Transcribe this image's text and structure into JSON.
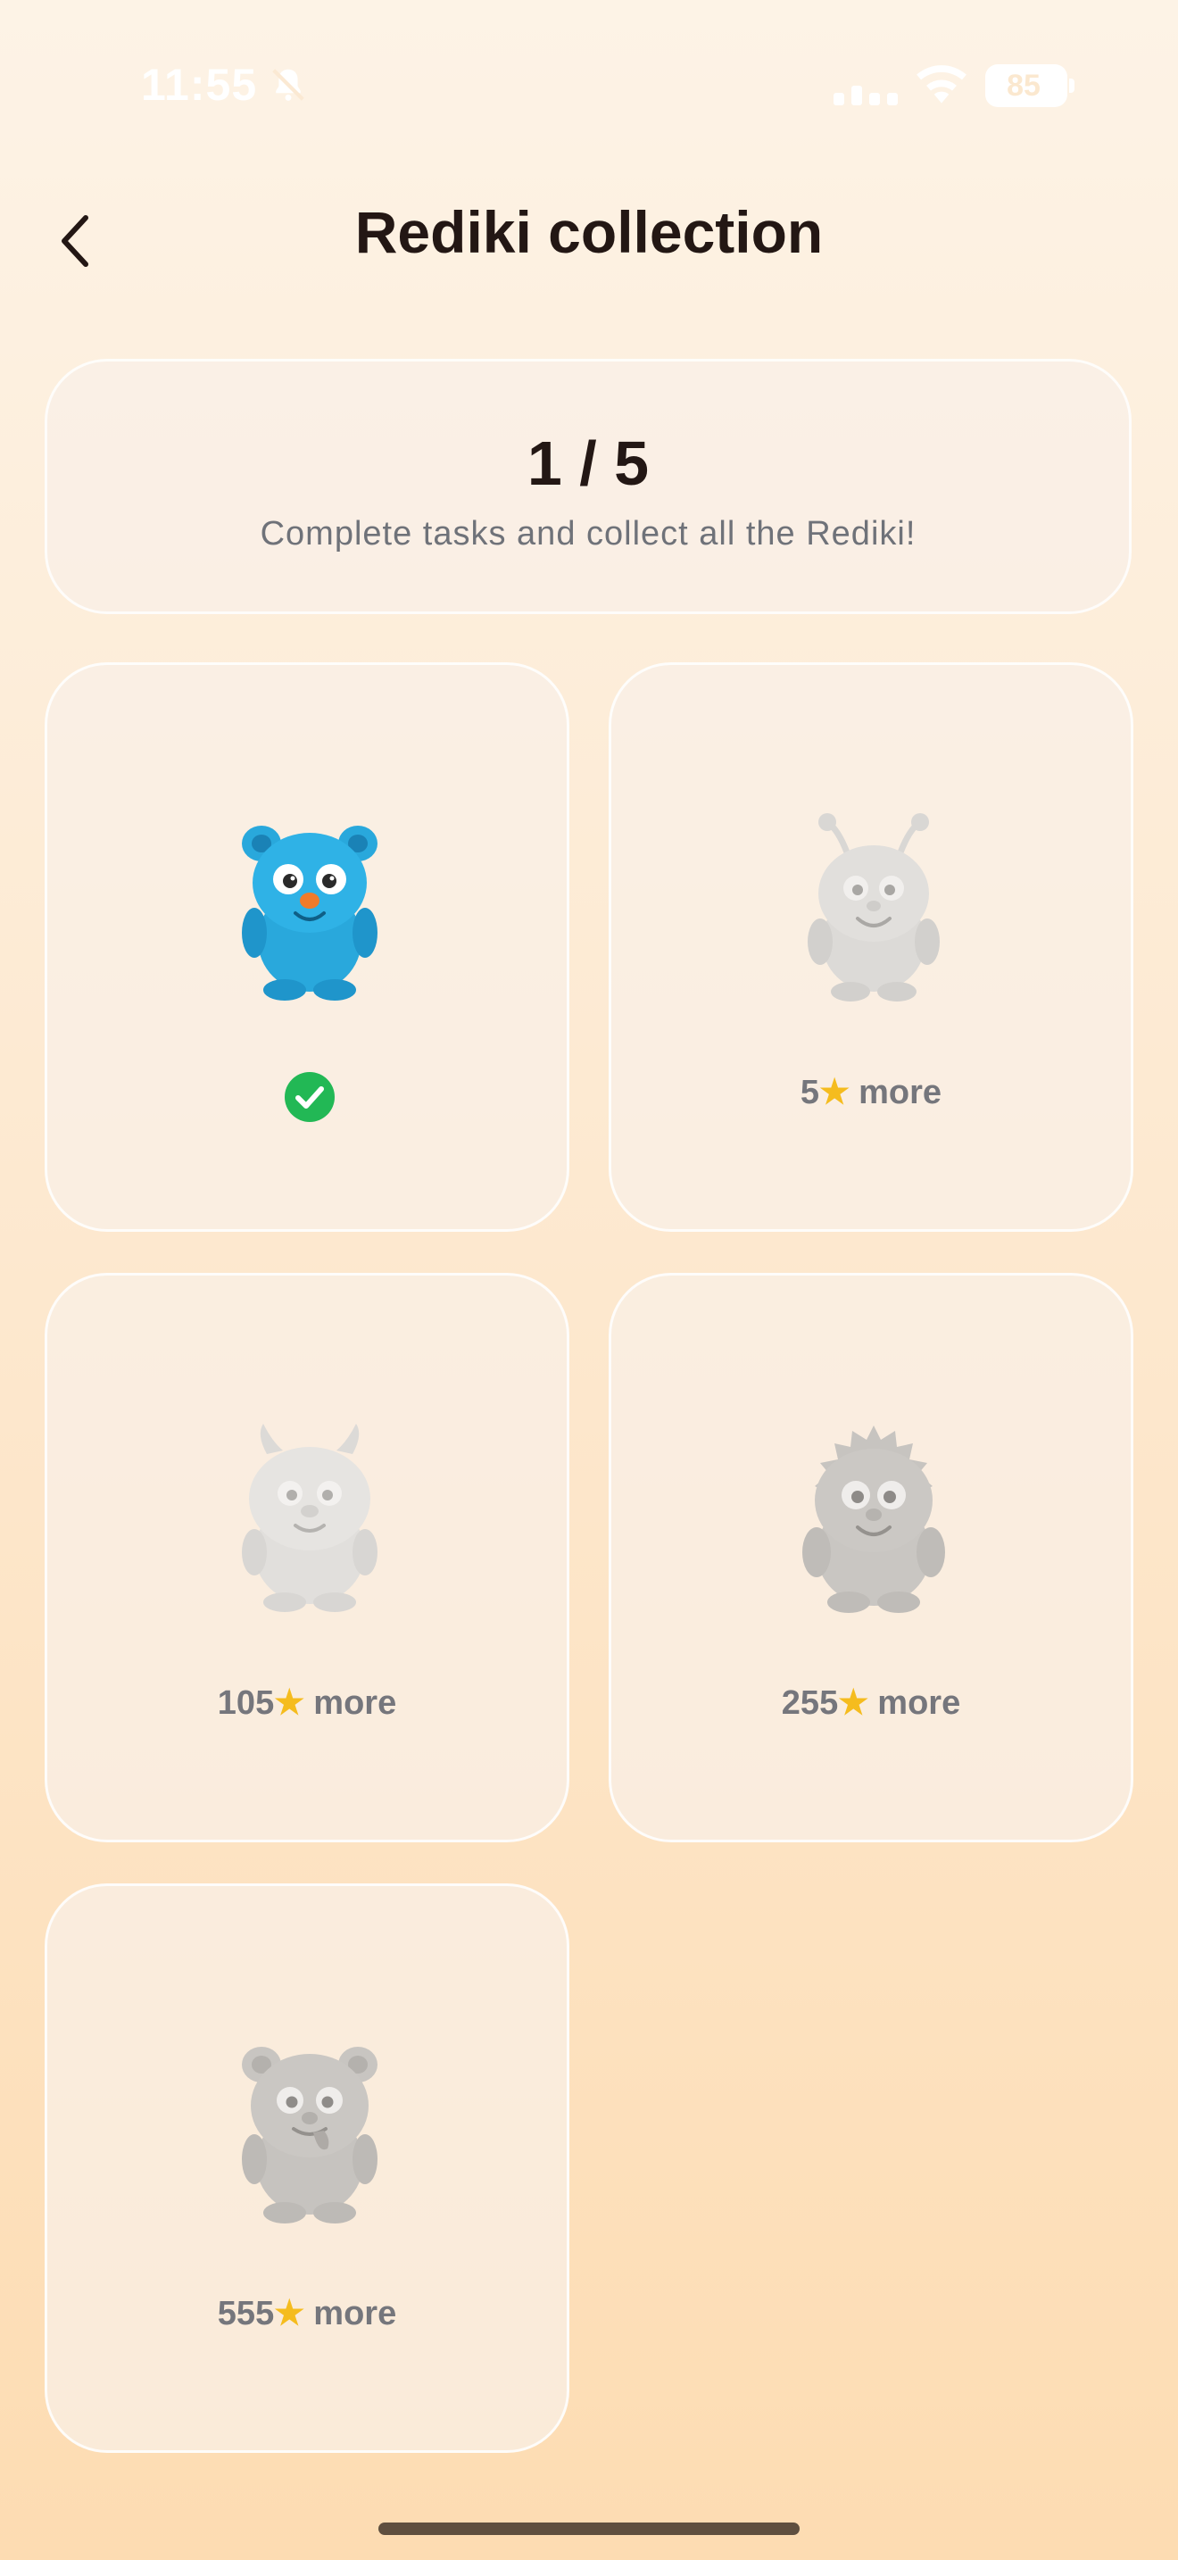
{
  "status": {
    "time": "11:55",
    "battery": "85"
  },
  "header": {
    "title": "Rediki collection"
  },
  "summary": {
    "progress": "1 / 5",
    "subtitle": "Complete tasks and collect all the Rediki!"
  },
  "collection": [
    {
      "state": "collected",
      "color": "#29a8dc"
    },
    {
      "state": "locked",
      "cost": "5",
      "unit": "more"
    },
    {
      "state": "locked",
      "cost": "105",
      "unit": "more"
    },
    {
      "state": "locked",
      "cost": "255",
      "unit": "more"
    },
    {
      "state": "locked",
      "cost": "555",
      "unit": "more"
    }
  ],
  "icons": {
    "back": "chevron-left-icon",
    "collected": "check-circle-icon",
    "cost": "star-icon"
  },
  "colors": {
    "accent_green": "#22b855",
    "locked_gray": "#cbc8c4",
    "title": "#231714"
  }
}
